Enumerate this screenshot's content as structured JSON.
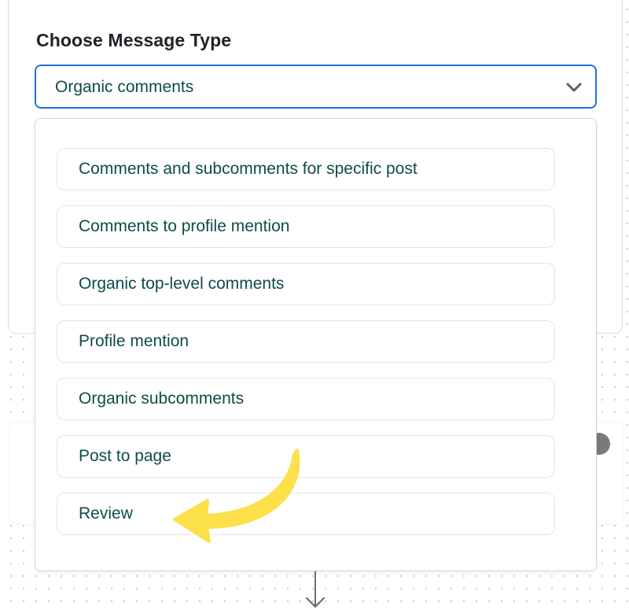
{
  "form": {
    "label": "Choose Message Type",
    "selected_value": "Organic comments"
  },
  "dropdown": {
    "options": [
      {
        "label": "Comments and subcomments for specific post"
      },
      {
        "label": "Comments to profile mention"
      },
      {
        "label": "Organic top-level comments"
      },
      {
        "label": "Profile mention"
      },
      {
        "label": "Organic subcomments"
      },
      {
        "label": "Post to page"
      },
      {
        "label": "Review"
      }
    ]
  },
  "colors": {
    "accent_border": "#1f6fe0",
    "option_text": "#0d4d47",
    "highlight_arrow": "#fbe04a"
  },
  "icons": {
    "select_chevron": "chevron-down-icon",
    "connector": "arrow-down-icon",
    "annotation": "yellow-curved-arrow-icon"
  }
}
